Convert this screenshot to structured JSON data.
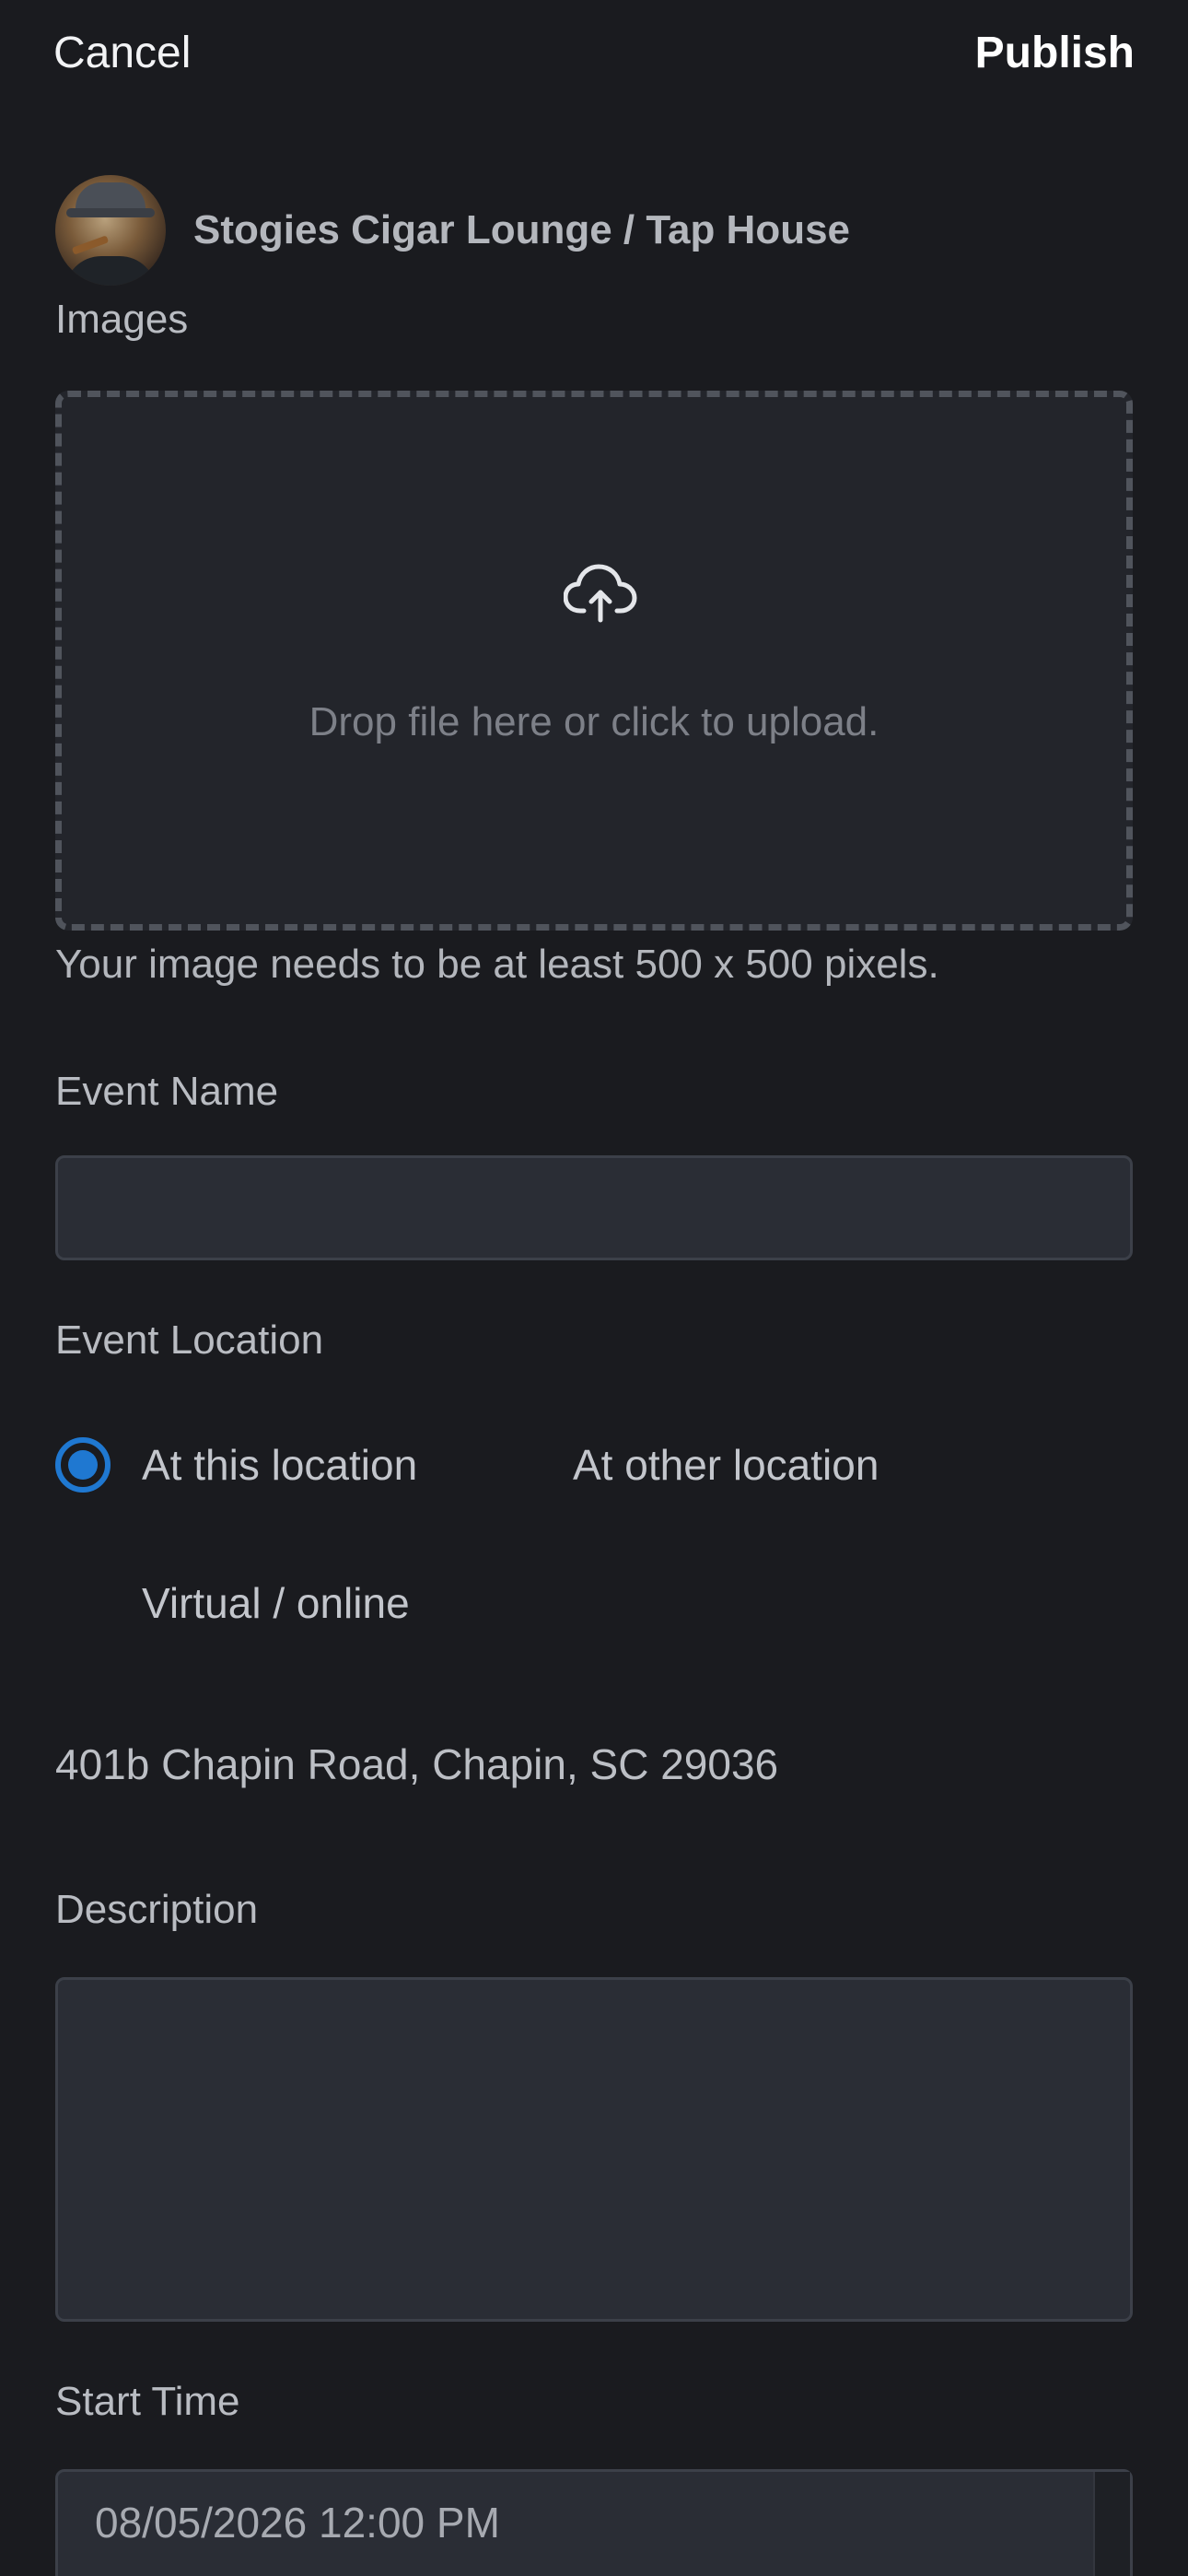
{
  "topbar": {
    "cancel_label": "Cancel",
    "publish_label": "Publish"
  },
  "venue": {
    "name": "Stogies Cigar Lounge / Tap House"
  },
  "images": {
    "label": "Images",
    "dropzone_text": "Drop file here or click to upload.",
    "hint": "Your image needs to be at least 500 x 500 pixels.",
    "icon": "cloud-upload-icon"
  },
  "event_name": {
    "label": "Event Name",
    "value": ""
  },
  "event_location": {
    "label": "Event Location",
    "options": [
      {
        "label": "At this location",
        "selected": true
      },
      {
        "label": "At other location",
        "selected": false
      },
      {
        "label": "Virtual / online",
        "selected": false
      }
    ],
    "address": "401b Chapin Road, Chapin, SC 29036"
  },
  "description": {
    "label": "Description",
    "value": ""
  },
  "start_time": {
    "label": "Start Time",
    "value": "08/05/2026 12:00 PM"
  },
  "colors": {
    "background": "#1a1b1f",
    "accent": "#1f78d1",
    "input_bg": "#2a2d35"
  }
}
